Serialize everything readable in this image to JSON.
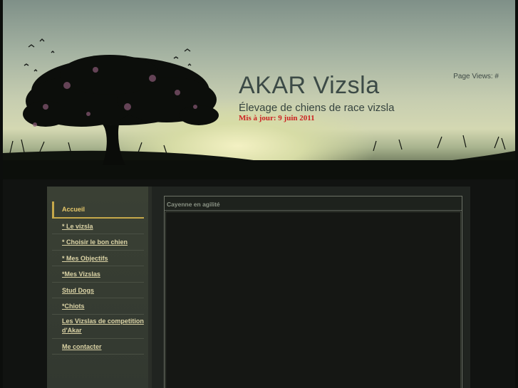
{
  "header": {
    "title": "AKAR Vizsla",
    "subtitle": "Élevage de chiens de race vizsla",
    "update_notice": "Mis à jour: 9 juin 2011",
    "page_views": "Page Views: #"
  },
  "nav": {
    "items": [
      {
        "label": "Accueil",
        "active": true
      },
      {
        "label": "* Le vizsla"
      },
      {
        "label": "* Choisir le bon chien"
      },
      {
        "label": "* Mes Objectifs"
      },
      {
        "label": "*Mes Vizslas "
      },
      {
        "label": "Stud Dogs"
      },
      {
        "label": "*Chiots"
      },
      {
        "label": "Les Vizslas de competition d'Akar"
      },
      {
        "label": "Me contacter"
      }
    ]
  },
  "main": {
    "section_title": "Cayenne en agilité"
  },
  "colors": {
    "page_background": "#111311",
    "title_text": "#3c4a46",
    "update_text": "#cc2222",
    "nav_link": "#dcd4a6",
    "nav_active_accent": "#c6a84a"
  }
}
